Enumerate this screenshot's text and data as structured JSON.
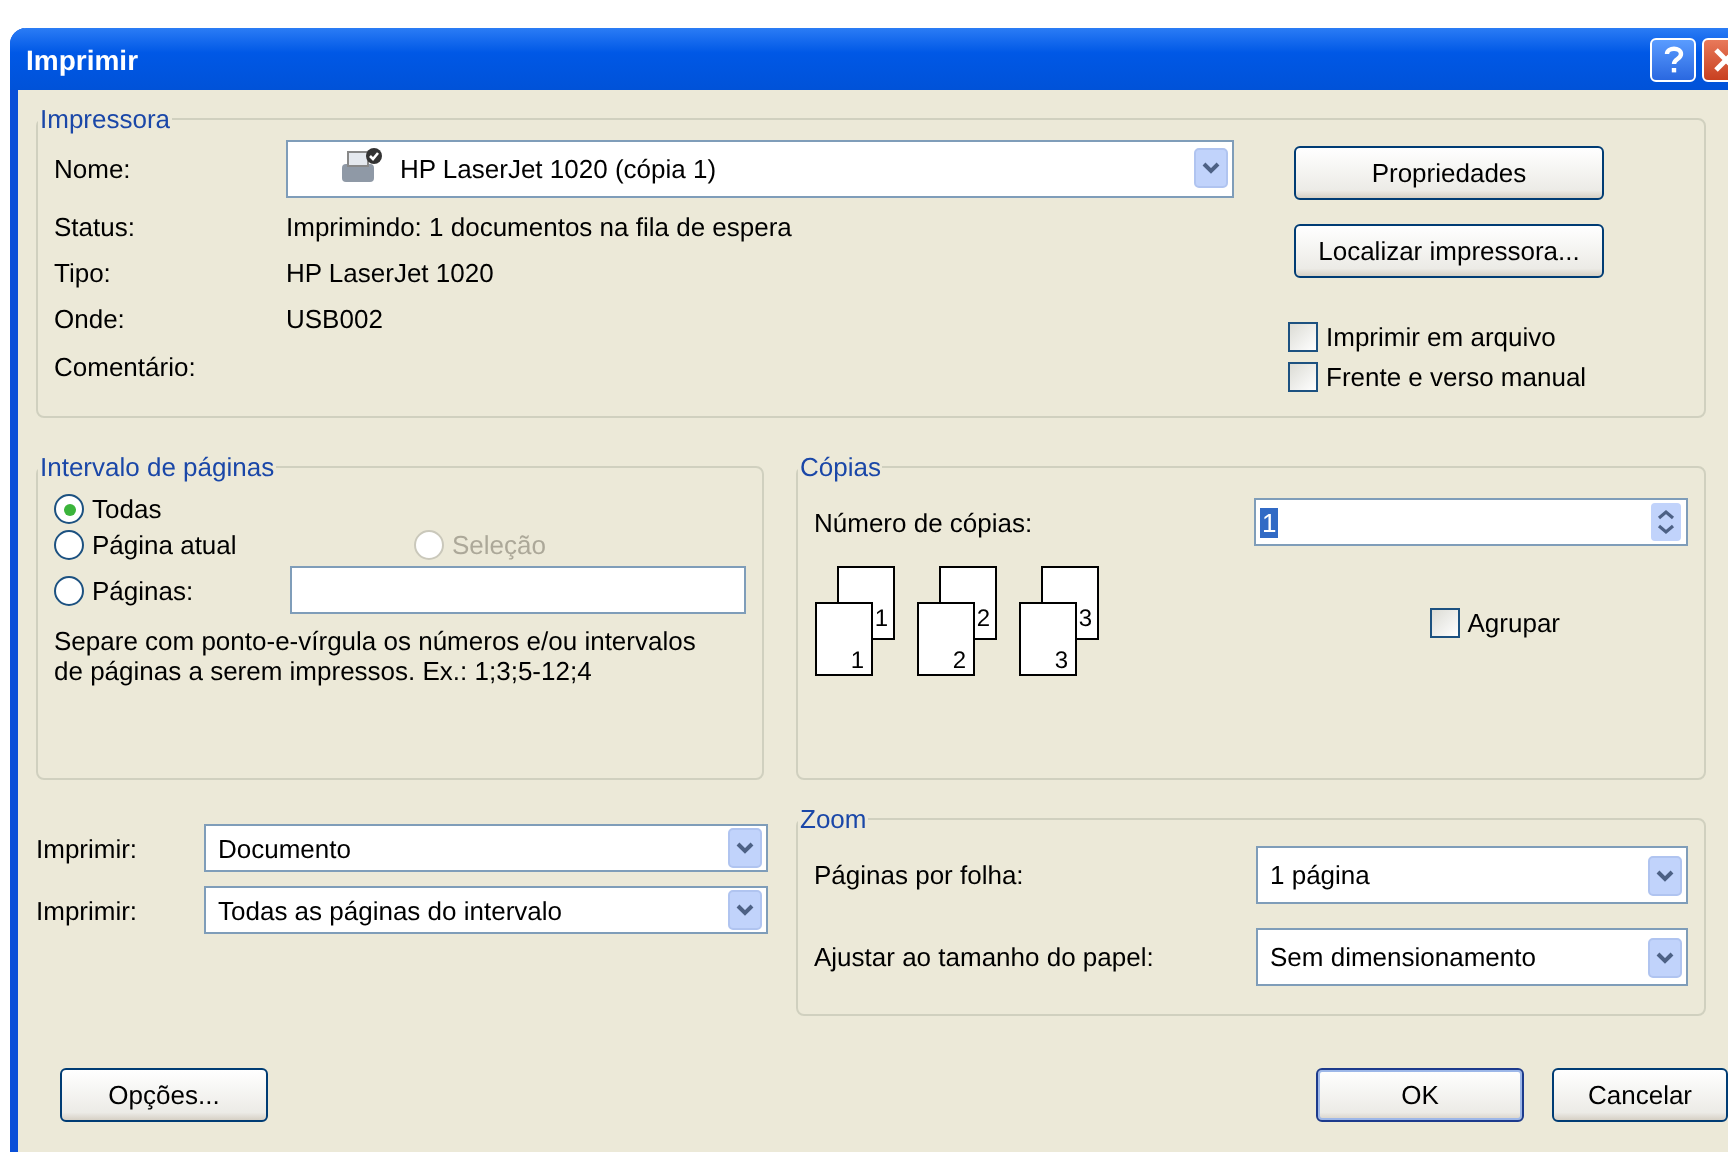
{
  "window": {
    "title": "Imprimir"
  },
  "printer": {
    "title": "Impressora",
    "name_label": "Nome:",
    "name_value": "HP LaserJet 1020 (cópia 1)",
    "info": [
      {
        "label": "Status:",
        "value": "Imprimindo: 1 documentos na fila de espera"
      },
      {
        "label": "Tipo:",
        "value": "HP LaserJet 1020"
      },
      {
        "label": "Onde:",
        "value": "USB002"
      },
      {
        "label": "Comentário:"
      }
    ],
    "buttons": [
      "Propriedades",
      "Localizar impressora..."
    ],
    "options": [
      {
        "label": "Imprimir em arquivo",
        "checked": false
      },
      {
        "label": "Frente e verso manual",
        "checked": false
      }
    ]
  },
  "page_range": {
    "title": "Intervalo de páginas",
    "options": [
      {
        "label": "Todas",
        "selected": true,
        "disabled": false
      },
      {
        "label": "Página atual",
        "selected": false,
        "disabled": false
      },
      {
        "label": "Seleção",
        "selected": false,
        "disabled": true
      },
      {
        "label": "Páginas:",
        "selected": false,
        "disabled": false
      }
    ],
    "hint": "Separe com ponto-e-vírgula os números e/ou intervalos de páginas a serem impressos.  Ex.: 1;3;5-12;4"
  },
  "copies": {
    "title": "Cópias",
    "count_label": "Número de cópias:",
    "count": "1",
    "count_highlighted": true,
    "pages": [
      {
        "back": "1",
        "front": "1"
      },
      {
        "back": "2",
        "front": "2"
      },
      {
        "back": "3",
        "front": "3"
      }
    ],
    "collate": {
      "label": "Agrupar",
      "checked": false
    }
  },
  "print_what": [
    {
      "label": "Imprimir:",
      "value": "Documento"
    },
    {
      "label": "Imprimir:",
      "value": "Todas as páginas do intervalo"
    }
  ],
  "zoom": {
    "title": "Zoom",
    "rows": [
      {
        "label": "Páginas por folha:",
        "value": "1 página"
      },
      {
        "label": "Ajustar ao tamanho do papel:",
        "value": "Sem dimensionamento"
      }
    ]
  },
  "footer": {
    "options": "Opções...",
    "ok": "OK",
    "cancel": "Cancelar"
  }
}
